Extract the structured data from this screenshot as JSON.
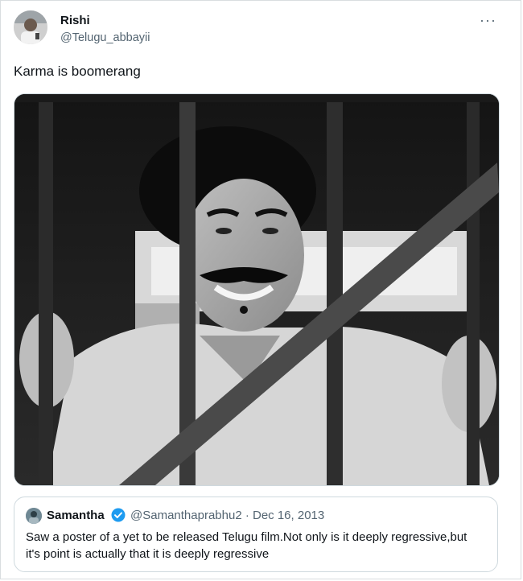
{
  "tweet": {
    "author_name": "Rishi",
    "author_handle": "@Telugu_abbayii",
    "more_icon": "more-horizontal-icon",
    "text": "Karma is boomerang"
  },
  "quoted_tweet": {
    "author_name": "Samantha",
    "verified_icon": "verified-badge-icon",
    "author_handle": "@Samanthaprabhu2",
    "separator": "·",
    "date": "Dec 16, 2013",
    "text": "Saw a poster of a yet to be released Telugu film.Not only is it deeply regressive,but it's point is actually that it is deeply regressive"
  },
  "colors": {
    "text": "#0f1419",
    "secondary": "#536471",
    "border": "#cfd9de",
    "verified": "#1d9bf0"
  }
}
